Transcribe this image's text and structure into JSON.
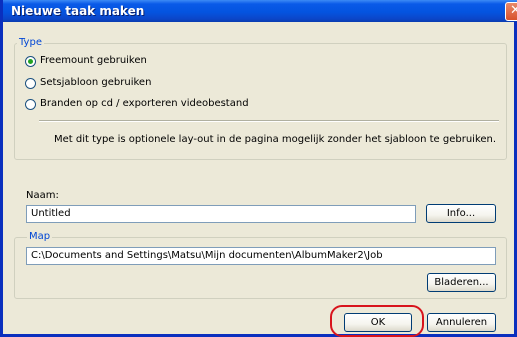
{
  "window": {
    "title": "Nieuwe taak maken"
  },
  "type_group": {
    "label": "Type",
    "options": [
      {
        "label": "Freemount gebruiken",
        "selected": true
      },
      {
        "label": "Setsjabloon gebruiken",
        "selected": false
      },
      {
        "label": "Branden op cd / exporteren videobestand",
        "selected": false
      }
    ],
    "description": "Met dit type is optionele lay-out in de pagina mogelijk zonder het sjabloon te gebruiken."
  },
  "name": {
    "label": "Naam:",
    "value": "Untitled",
    "info_button": "Info..."
  },
  "map_group": {
    "label": "Map",
    "path": "C:\\Documents and Settings\\Matsu\\Mijn documenten\\AlbumMaker2\\Job",
    "browse_button": "Bladeren..."
  },
  "footer": {
    "ok_button": "OK",
    "cancel_button": "Annuleren"
  },
  "colors": {
    "title_bar": "#0454e0",
    "group_label": "#0046d5",
    "highlight": "#d8141c"
  }
}
